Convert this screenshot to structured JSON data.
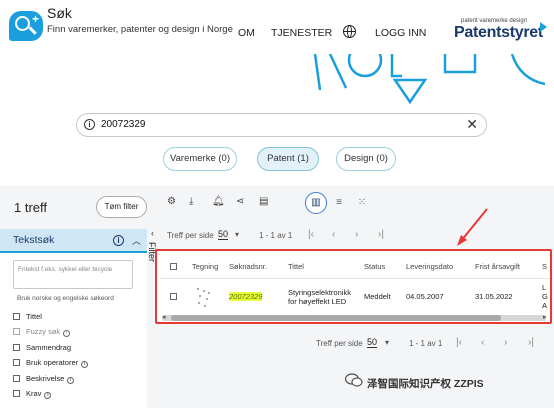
{
  "app": {
    "title": "Søk",
    "subtitle": "Finn varemerker, patenter og design i Norge"
  },
  "nav": {
    "items": [
      "OM",
      "TJENESTER",
      "LOGG INN"
    ],
    "globe_icon": "globe-icon"
  },
  "brand": {
    "tagline": "patent varemerke design",
    "name": "Patentstyret"
  },
  "search": {
    "value": "20072329"
  },
  "categories": [
    {
      "label": "Varemerke (0)",
      "active": false
    },
    {
      "label": "Patent (1)",
      "active": true
    },
    {
      "label": "Design (0)",
      "active": false
    }
  ],
  "results": {
    "count_label": "1 treff",
    "clear_filter_label": "Tøm filter"
  },
  "text_search": {
    "title": "Tekstsøk",
    "placeholder": "Fritekst f.eks. sykkel eller bicycle",
    "hint": "Bruk norske og engelske søkeord",
    "fields": [
      {
        "label": "Tittel",
        "muted": false,
        "info": false
      },
      {
        "label": "Fuzzy søk",
        "muted": true,
        "info": true
      },
      {
        "label": "Sammendrag",
        "muted": false,
        "info": false
      },
      {
        "label": "Bruk operatorer",
        "muted": false,
        "info": true
      },
      {
        "label": "Beskrivelse",
        "muted": false,
        "info": true
      },
      {
        "label": "Krav",
        "muted": false,
        "info": true
      }
    ]
  },
  "filter_label": "Filter",
  "pager": {
    "per_page_label": "Treff per side",
    "per_page_value": "50",
    "range_label": "1 - 1 av 1"
  },
  "table": {
    "columns": [
      "Tegning",
      "Søknadsnr.",
      "Tittel",
      "Status",
      "Leveringsdato",
      "Frist årsavgift",
      "S"
    ],
    "rows": [
      {
        "application_no": "20072329",
        "title_line1": "Styringselektronikk",
        "title_line2": "for høyeffekt LED",
        "status": "Meddelt",
        "filing_date": "04.05.2007",
        "fee_deadline": "31.05.2022",
        "s_col": [
          "L",
          "G",
          "A"
        ]
      }
    ]
  },
  "watermark": {
    "text": "泽智国际知识产权 ZZPIS"
  },
  "colors": {
    "accent": "#1a9fdc",
    "brand_dark": "#1a3a6b",
    "highlight_border": "#e53935",
    "appno_highlight": "#e8ff3a"
  }
}
